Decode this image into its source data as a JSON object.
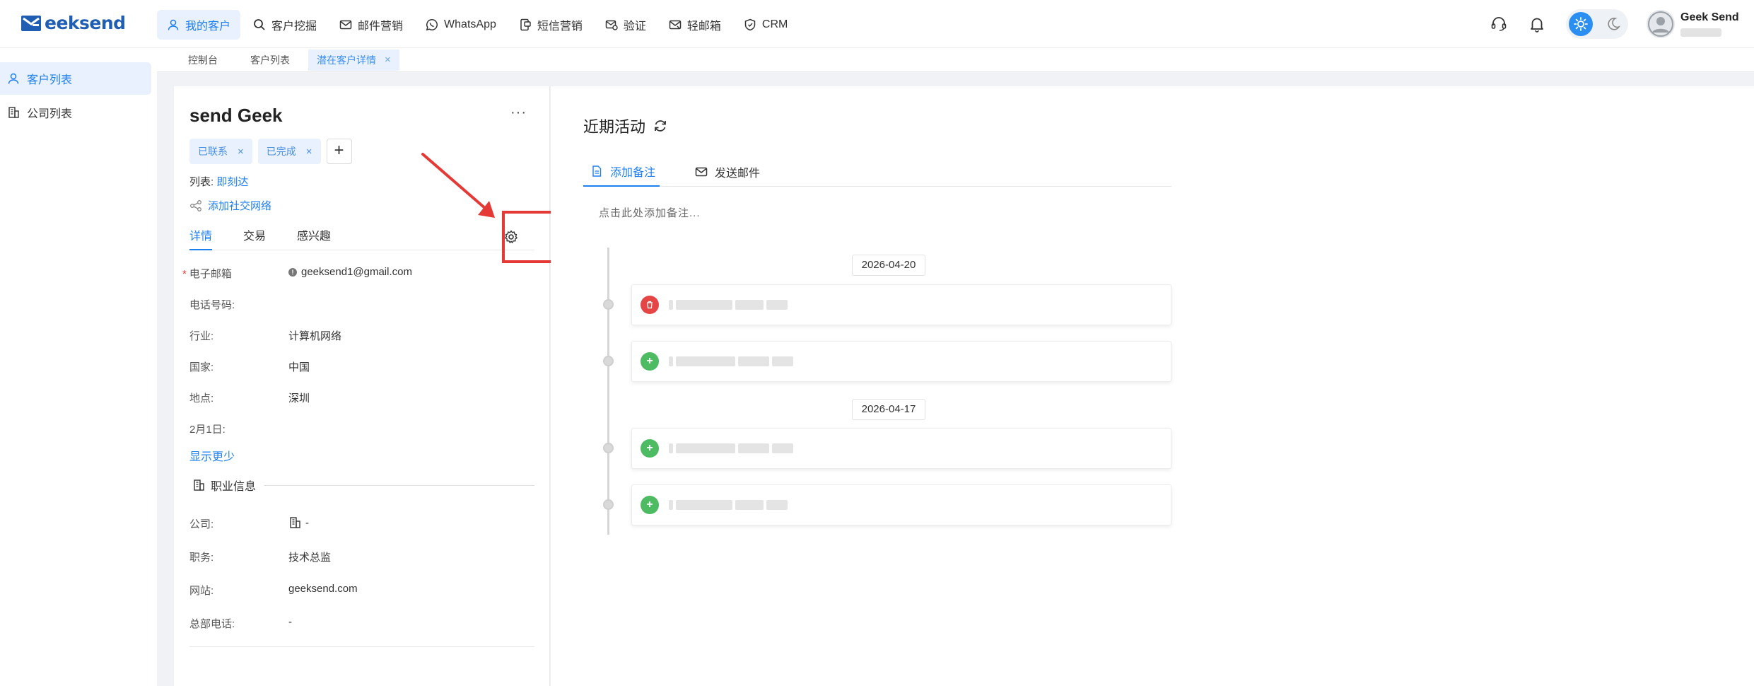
{
  "app": {
    "logo_text": "eeksend",
    "brand_color": "#1f5eb3",
    "accent_color": "#1e7ff0"
  },
  "nav": {
    "items": [
      {
        "label": "我的客户",
        "icon": "user-icon",
        "active": true
      },
      {
        "label": "客户挖掘",
        "icon": "search-icon",
        "active": false
      },
      {
        "label": "邮件营销",
        "icon": "mail-icon",
        "active": false
      },
      {
        "label": "WhatsApp",
        "icon": "whatsapp-icon",
        "active": false
      },
      {
        "label": "短信营销",
        "icon": "sms-icon",
        "active": false
      },
      {
        "label": "验证",
        "icon": "verify-mail-icon",
        "active": false
      },
      {
        "label": "轻邮箱",
        "icon": "light-mail-icon",
        "active": false
      },
      {
        "label": "CRM",
        "icon": "crm-shield-icon",
        "active": false
      }
    ]
  },
  "header": {
    "support_icon": "headset-icon",
    "notify_icon": "bell-icon",
    "theme": "light",
    "user_name": "Geek Send"
  },
  "page_tabs": [
    {
      "label": "控制台",
      "active": false
    },
    {
      "label": "客户列表",
      "active": false
    },
    {
      "label": "潜在客户详情",
      "active": true,
      "close": "×"
    }
  ],
  "sidebar": {
    "items": [
      {
        "label": "客户列表",
        "icon": "user-icon",
        "active": true
      },
      {
        "label": "公司列表",
        "icon": "building-icon",
        "active": false
      }
    ]
  },
  "customer": {
    "name": "send Geek",
    "more": "···",
    "tags": [
      {
        "label": "已联系",
        "close": "×"
      },
      {
        "label": "已完成",
        "close": "×"
      }
    ],
    "add_tag": "+",
    "list_label": "列表:",
    "list_value": "即刻达",
    "social_link": "添加社交网络",
    "tabs": [
      "详情",
      "交易",
      "感兴趣"
    ],
    "fields": [
      {
        "label": "电子邮箱",
        "required": "*",
        "value": "geeksend1@gmail.com"
      },
      {
        "label": "电话号码:",
        "value": ""
      },
      {
        "label": "行业:",
        "value": "计算机网络"
      },
      {
        "label": "国家:",
        "value": "中国"
      },
      {
        "label": "地点:",
        "value": "深圳"
      },
      {
        "label": "2月1日:",
        "value": ""
      }
    ],
    "show_less": "显示更少",
    "job_section": "职业信息",
    "job_fields": [
      {
        "label": "公司:",
        "value": "-"
      },
      {
        "label": "职务:",
        "value": "技术总监"
      },
      {
        "label": "网站:",
        "value": "geeksend.com"
      },
      {
        "label": "总部电话:",
        "value": "-"
      }
    ]
  },
  "activity": {
    "title": "近期活动",
    "tabs": [
      {
        "label": "添加备注",
        "icon": "note-icon",
        "active": true
      },
      {
        "label": "发送邮件",
        "icon": "mail-icon",
        "active": false
      }
    ],
    "note_placeholder": "点击此处添加备注...",
    "timeline": [
      {
        "date": "2026-04-20",
        "events": [
          {
            "type": "delete",
            "icon": "trash-icon"
          },
          {
            "type": "add",
            "icon": "plus-icon"
          }
        ]
      },
      {
        "date": "2026-04-17",
        "events": [
          {
            "type": "add",
            "icon": "plus-icon"
          },
          {
            "type": "add",
            "icon": "plus-icon"
          }
        ]
      }
    ]
  },
  "annotation": {
    "highlight_color": "#e53935"
  }
}
